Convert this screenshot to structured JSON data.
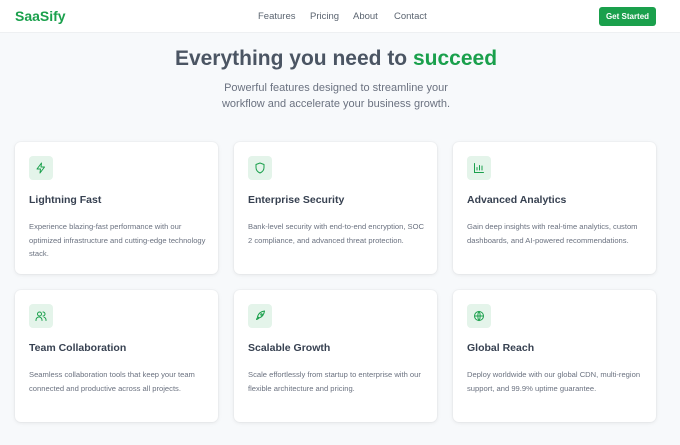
{
  "nav": {
    "logo": "SaaSify",
    "links": [
      "Features",
      "Pricing",
      "About",
      "Contact"
    ],
    "cta_label": "Get Started"
  },
  "hero": {
    "title_prefix": "Everything you need to ",
    "title_accent": "succeed",
    "subtitle": "Powerful features designed to streamline your workflow and accelerate your business growth."
  },
  "features": [
    {
      "icon": "lightning-icon",
      "title": "Lightning Fast",
      "desc": "Experience blazing-fast performance with our optimized infrastructure and cutting-edge technology stack."
    },
    {
      "icon": "shield-icon",
      "title": "Enterprise Security",
      "desc": "Bank-level security with end-to-end encryption, SOC 2 compliance, and advanced threat protection."
    },
    {
      "icon": "bar-chart-icon",
      "title": "Advanced Analytics",
      "desc": "Gain deep insights with real-time analytics, custom dashboards, and AI-powered recommendations."
    },
    {
      "icon": "users-icon",
      "title": "Team Collaboration",
      "desc": "Seamless collaboration tools that keep your team connected and productive across all projects."
    },
    {
      "icon": "rocket-icon",
      "title": "Scalable Growth",
      "desc": "Scale effortlessly from startup to enterprise with our flexible architecture and pricing."
    },
    {
      "icon": "globe-icon",
      "title": "Global Reach",
      "desc": "Deploy worldwide with our global CDN, multi-region support, and 99.9% uptime guarantee."
    }
  ],
  "colors": {
    "accent": "#1aa04c",
    "accent_light": "#e4f4ea",
    "text_dark": "#374151",
    "text_muted": "#6b7280",
    "background": "#f7f9fb"
  }
}
